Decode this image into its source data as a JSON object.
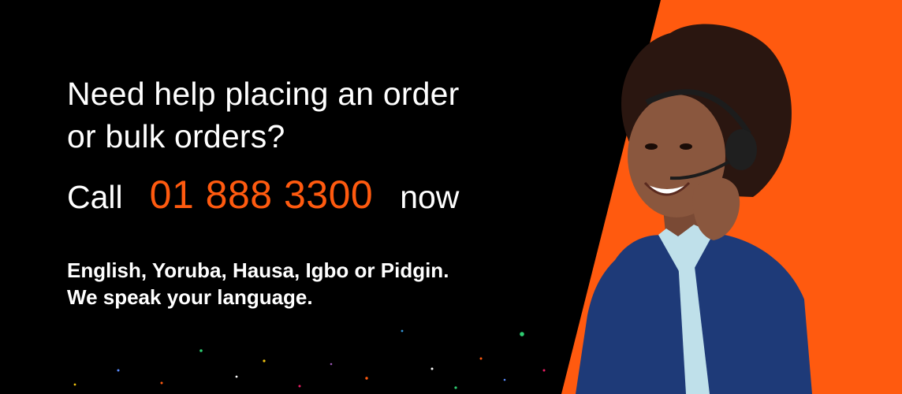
{
  "banner": {
    "headline_line1": "Need help placing an order",
    "headline_line2": "or bulk orders?",
    "call_prefix": "Call",
    "phone_number": "01 888 3300",
    "call_suffix": "now",
    "languages_line1": "English, Yoruba, Hausa, Igbo or Pidgin.",
    "languages_line2": "We speak your language."
  },
  "colors": {
    "background": "#000000",
    "accent_orange": "#FF5A0F",
    "text": "#FFFFFF"
  },
  "icons": {
    "agent_photo": "customer-support-agent-with-headset"
  }
}
